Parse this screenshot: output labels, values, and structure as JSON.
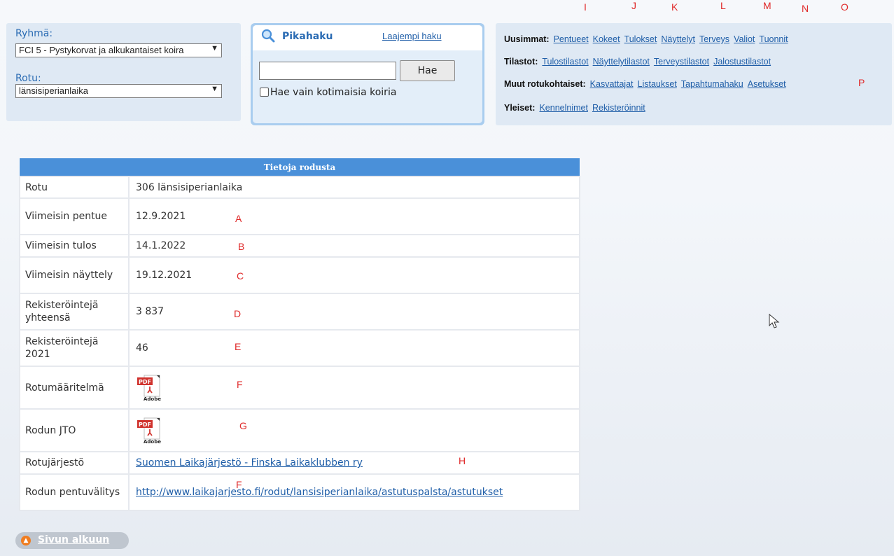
{
  "left_panel": {
    "ryhma_label": "Ryhmä:",
    "ryhma_value": "FCI 5 - Pystykorvat ja alkukantaiset koira",
    "rotu_label": "Rotu:",
    "rotu_value": "länsisiperianlaika"
  },
  "search": {
    "title": "Pikahaku",
    "advanced_link": "Laajempi haku",
    "input_value": "",
    "button": "Hae",
    "checkbox_label": "Hae vain kotimaisia koiria"
  },
  "links": {
    "uusimmat_label": "Uusimmat:",
    "uusimmat": [
      "Pentueet",
      "Kokeet",
      "Tulokset",
      "Näyttelyt",
      "Terveys",
      "Valiot",
      "Tuonnit"
    ],
    "tilastot_label": "Tilastot:",
    "tilastot": [
      "Tulostilastot",
      "Näyttelytilastot",
      "Terveystilastot",
      "Jalostustilastot"
    ],
    "muut_label": "Muut rotukohtaiset:",
    "muut": [
      "Kasvattajat",
      "Listaukset",
      "Tapahtumahaku",
      "Asetukset"
    ],
    "yleiset_label": "Yleiset:",
    "yleiset": [
      "Kennelnimet",
      "Rekisteröinnit"
    ]
  },
  "annotations": {
    "I": "I",
    "J": "J",
    "K": "K",
    "L": "L",
    "M": "M",
    "N": "N",
    "O": "O",
    "P": "P",
    "A": "A",
    "B": "B",
    "C": "C",
    "D": "D",
    "E": "E",
    "F": "F",
    "G": "G",
    "H": "H",
    "F2": "F"
  },
  "table": {
    "header": "Tietoja rodusta",
    "rows": [
      {
        "key": "Rotu",
        "value": "306 länsisiperianlaika"
      },
      {
        "key": "Viimeisin pentue",
        "value": "12.9.2021"
      },
      {
        "key": "Viimeisin tulos",
        "value": "14.1.2022"
      },
      {
        "key": "Viimeisin näyttely",
        "value": "19.12.2021"
      },
      {
        "key": "Rekisteröintejä yhteensä",
        "value": "3 837"
      },
      {
        "key": "Rekisteröintejä 2021",
        "value": "46"
      },
      {
        "key": "Rotumääritelmä",
        "value": ""
      },
      {
        "key": "Rodun JTO",
        "value": ""
      },
      {
        "key": "Rotujärjestö",
        "value": "Suomen Laikajärjestö - Finska Laikaklubben ry"
      },
      {
        "key": "Rodun pentuvälitys",
        "value": "http://www.laikajarjesto.fi/rodut/lansisiperianlaika/astutuspalsta/astutukset"
      }
    ]
  },
  "pdf_icon": {
    "label": "PDF",
    "brand": "Adobe"
  },
  "back_to_top": "Sivun alkuun",
  "colors": {
    "accent": "#4a90d9",
    "link": "#1f5ea8",
    "annotation": "#e02b2b"
  }
}
